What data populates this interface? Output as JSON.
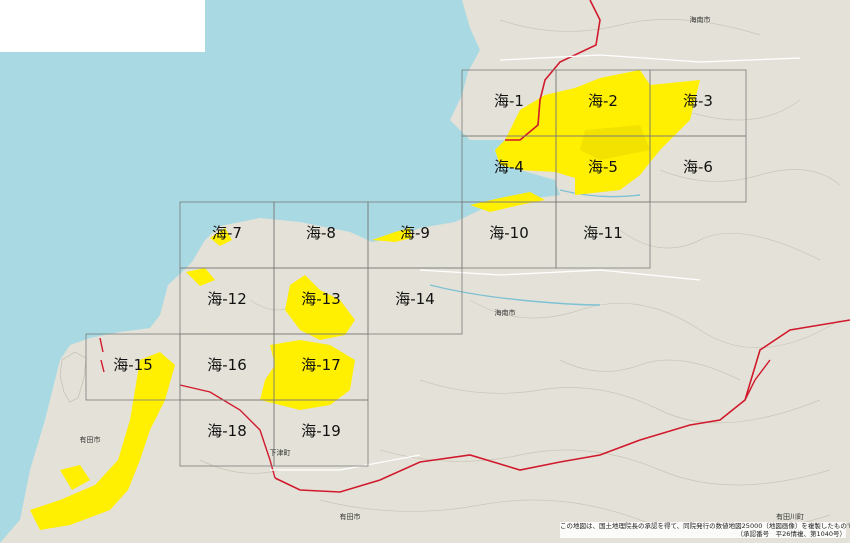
{
  "map": {
    "grid_cells": [
      {
        "label": "海-1"
      },
      {
        "label": "海-2"
      },
      {
        "label": "海-3"
      },
      {
        "label": "海-4"
      },
      {
        "label": "海-5"
      },
      {
        "label": "海-6"
      },
      {
        "label": "海-7"
      },
      {
        "label": "海-8"
      },
      {
        "label": "海-9"
      },
      {
        "label": "海-10"
      },
      {
        "label": "海-11"
      },
      {
        "label": "海-12"
      },
      {
        "label": "海-13"
      },
      {
        "label": "海-14"
      },
      {
        "label": "海-15"
      },
      {
        "label": "海-16"
      },
      {
        "label": "海-17"
      },
      {
        "label": "海-18"
      },
      {
        "label": "海-19"
      }
    ],
    "place_names": [
      {
        "text": "海南市"
      },
      {
        "text": "海南市"
      },
      {
        "text": "有田市"
      },
      {
        "text": "有田川町"
      },
      {
        "text": "有田市"
      },
      {
        "text": "下津町"
      }
    ],
    "credit_line1": "この地図は、国土地理院長の承認を得て、同院発行の数値地図25000（地図画像）を複製したものである。",
    "credit_line2": "（承認番号　平26情複、第1040号）"
  },
  "colors": {
    "sea": "#a9d9e2",
    "land": "#e4e2d8",
    "highlight": "#ffef00",
    "boundary": "#d1192c",
    "grid": "#7a7a7a"
  }
}
